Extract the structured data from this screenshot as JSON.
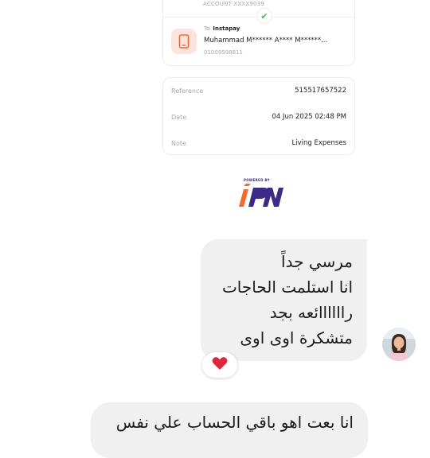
{
  "transfer": {
    "account_line": "ACCOUNT XXXX9039",
    "status_icon": "check-icon",
    "to_label": "To",
    "to_service": "Instapay",
    "recipient_name": "Muhammad M****** A**** M******...",
    "recipient_phone": "01009598811",
    "reference_label": "Reference",
    "reference_value": "515517657522",
    "date_label": "Date",
    "date_value": "04 Jun 2025 02:48 PM",
    "note_label": "Note",
    "note_value": "Living Expenses",
    "powered_by": "POWERED BY"
  },
  "chat": {
    "message_1_lines": [
      "مرسي جداً",
      "انا استلمت الحاجات",
      "راااااائعه بجد",
      "متشكرة اوى اوى"
    ],
    "reaction": "❤️",
    "message_2": "انا بعت اهو باقي الحساب علي نفس"
  },
  "colors": {
    "accent_orange": "#f26a2e",
    "brand_purple": "#3b2a86",
    "bubble_bg": "#f0f0f1",
    "check_green": "#35c24e",
    "heart_red": "#e0243a"
  }
}
